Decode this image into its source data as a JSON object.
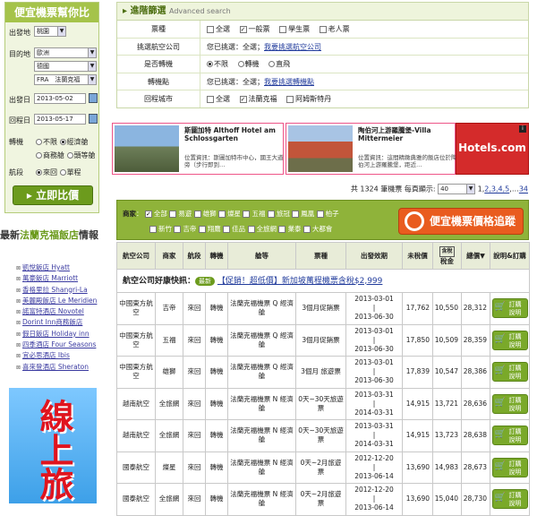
{
  "search": {
    "title": "便宜機票幫你比",
    "origin_label": "出發地",
    "origin_value": "桃園",
    "dest_label": "目的地",
    "dest_region": "歐洲",
    "dest_country": "德國",
    "dest_city": "FRA　法蘭克福",
    "depart_label": "出發日",
    "depart_value": "2013-05-02",
    "return_label": "回程日",
    "return_value": "2013-05-17",
    "stops_label": "轉機",
    "stops_opt1": "不限",
    "stops_opt2": "經濟艙",
    "stops_opt3": "商務艙",
    "stops_opt4": "頭等艙",
    "trip_label": "航段",
    "trip_opt1": "來回",
    "trip_opt2": "單程",
    "compare_button": "立即比價"
  },
  "hotels": {
    "title_prefix": "最新",
    "title_highlight": "法蘭克福飯店",
    "title_suffix": "情報",
    "items": [
      "凱悅飯店 Hyatt",
      "萬豪飯店 Marriott",
      "香格里拉 Shangri-La",
      "美麗殿飯店 Le Meridien",
      "諾富特酒店 Novotel",
      "Dorint Inn商務飯店",
      "假日飯店 Holiday inn",
      "四季酒店 Four Seasons",
      "宜必思酒店 Ibis",
      "喜來登酒店 Sheraton"
    ],
    "banner_text": "線上旅"
  },
  "advanced": {
    "title": "進階篩選",
    "title_en": "Advanced search",
    "ticket_label": "票種",
    "ticket_all": "全選",
    "ticket_adult": "一般票",
    "ticket_student": "學生票",
    "ticket_senior": "老人票",
    "airline_label": "挑選航空公司",
    "airline_selected_prefix": "您已挑選：",
    "airline_selected_value": "全選",
    "airline_link": "我要挑選航空公司",
    "transfer_label": "是否轉機",
    "transfer_any": "不限",
    "transfer_yes": "轉機",
    "transfer_direct": "直飛",
    "transfer_point_label": "轉機點",
    "transfer_point_prefix": "您已挑選：",
    "transfer_point_value": "全選",
    "transfer_point_link": "我要挑選轉機點",
    "return_city_label": "回程城市",
    "return_all": "全選",
    "return_fra": "法蘭克福",
    "return_ams": "阿姆斯特丹"
  },
  "ads": {
    "ad1_title": "斯圖加特 Althoff Hotel am Schlossgarten",
    "ad1_loc": "位置資訊：斯圖加特市中心，國王大道旁（步行即到…",
    "ad2_title": "陶伯河上游羅騰堡-Villa Mittermeier",
    "ad2_loc": "位置資訊：這間精緻典雅的飯店位於陶伯河上游羅騰堡，距近…",
    "hotels_com": "Hotels.com",
    "info_badge": "i"
  },
  "pager": {
    "total_prefix": "共",
    "total": "1324",
    "total_suffix": "筆機票",
    "per_page_label": "每頁顯示:",
    "per_page": "40",
    "page_current": "1",
    "pages": "2,3,4,5",
    "page_sep": "…",
    "page_last": "34"
  },
  "filters": {
    "airline_label": "商家",
    "line1": [
      "全部",
      "易遊",
      "雄獅",
      "燦星",
      "五福",
      "旅冠",
      "鳳凰",
      "柏子"
    ],
    "line2": [
      "新竹",
      "吉帝",
      "翔鷹",
      "佳品",
      "全旅網",
      "業泰",
      "大都會"
    ],
    "alert_button": "便宜機票價格追蹤"
  },
  "table": {
    "headers": [
      "航空公司",
      "商家",
      "航段",
      "轉機",
      "艙等",
      "票種",
      "出發效期",
      "未稅價",
      "稅金",
      "總價",
      "說明&訂購"
    ],
    "tax_note": "含稅",
    "flash_label": "航空公司好康快訊：",
    "flash_badge": "最新",
    "flash_text": "【促銷！超低價】新加坡萬程機票含稅$2,999",
    "book_label_1": "訂購",
    "book_label_2": "說明",
    "rows": [
      {
        "airline": "中國東方航空",
        "agent": "吉帝",
        "leg": "來回",
        "transfer": "轉機",
        "cabin": "法蘭克福機票 Q 經濟艙",
        "type": "3個月促銷票",
        "from": "2013-03-01",
        "to": "2013-06-30",
        "net": "17,762",
        "tax": "10,550",
        "total": "28,312"
      },
      {
        "airline": "中國東方航空",
        "agent": "五福",
        "leg": "來回",
        "transfer": "轉機",
        "cabin": "法蘭克福機票 Q 經濟艙",
        "type": "3個月促銷票",
        "from": "2013-03-01",
        "to": "2013-06-30",
        "net": "17,850",
        "tax": "10,509",
        "total": "28,359"
      },
      {
        "airline": "中國東方航空",
        "agent": "雄獅",
        "leg": "來回",
        "transfer": "轉機",
        "cabin": "法蘭克福機票 Q 經濟艙",
        "type": "3個月 旅遊票",
        "from": "2013-03-01",
        "to": "2013-06-30",
        "net": "17,839",
        "tax": "10,547",
        "total": "28,386"
      },
      {
        "airline": "越南航空",
        "agent": "全旅網",
        "leg": "來回",
        "transfer": "轉機",
        "cabin": "法蘭克福機票 N 經濟艙",
        "type": "0天~30天旅遊票",
        "from": "2013-03-31",
        "to": "2014-03-31",
        "net": "14,915",
        "tax": "13,721",
        "total": "28,636"
      },
      {
        "airline": "越南航空",
        "agent": "全旅網",
        "leg": "來回",
        "transfer": "轉機",
        "cabin": "法蘭克福機票 N 經濟艙",
        "type": "0天~30天旅遊票",
        "from": "2013-03-31",
        "to": "2014-03-31",
        "net": "14,915",
        "tax": "13,723",
        "total": "28,638"
      },
      {
        "airline": "國泰航空",
        "agent": "燦星",
        "leg": "來回",
        "transfer": "轉機",
        "cabin": "法蘭克福機票 N 經濟艙",
        "type": "0天~2月旅遊票",
        "from": "2012-12-20",
        "to": "2013-06-14",
        "net": "13,690",
        "tax": "14,983",
        "total": "28,673"
      },
      {
        "airline": "國泰航空",
        "agent": "全旅網",
        "leg": "來回",
        "transfer": "轉機",
        "cabin": "法蘭克福機票 N 經濟艙",
        "type": "0天~2月旅遊票",
        "from": "2012-12-20",
        "to": "2013-06-14",
        "net": "13,690",
        "tax": "15,040",
        "total": "28,730"
      }
    ]
  },
  "colors": {
    "accent": "#6c9b1d",
    "alert": "#e95c1f",
    "link": "#223c9c"
  }
}
